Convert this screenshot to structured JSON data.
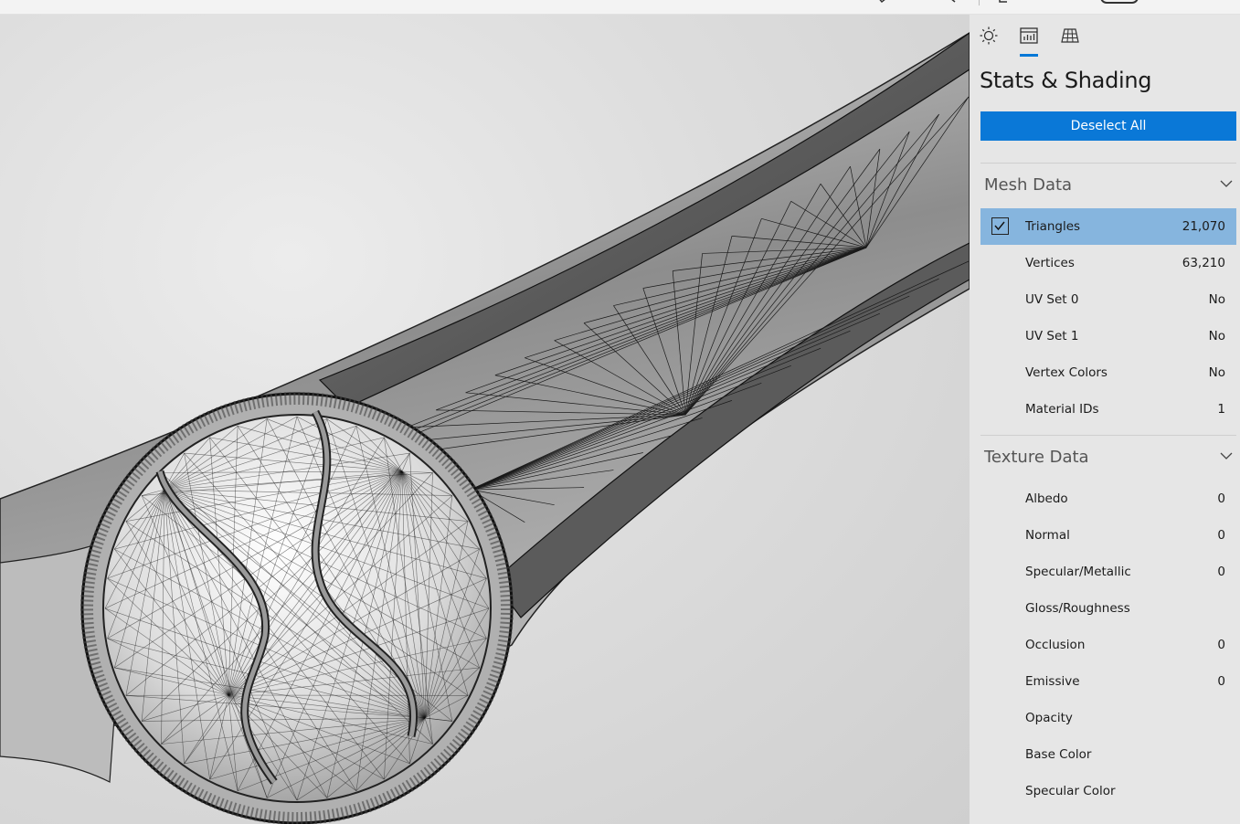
{
  "panel": {
    "title": "Stats & Shading",
    "tabs": [
      {
        "name": "lighting",
        "icon": "sun-icon"
      },
      {
        "name": "stats",
        "icon": "stats-icon",
        "active": true
      },
      {
        "name": "grid",
        "icon": "grid-icon"
      }
    ],
    "deselect_label": "Deselect All",
    "accent": "#0078d7",
    "selected_row_color": "#86b5de"
  },
  "mesh_data": {
    "header": "Mesh Data",
    "rows": [
      {
        "name": "Triangles",
        "value": "21,070",
        "selected": true
      },
      {
        "name": "Vertices",
        "value": "63,210"
      },
      {
        "name": "UV Set 0",
        "value": "No"
      },
      {
        "name": "UV Set 1",
        "value": "No"
      },
      {
        "name": "Vertex Colors",
        "value": "No"
      },
      {
        "name": "Material IDs",
        "value": "1"
      }
    ]
  },
  "texture_data": {
    "header": "Texture Data",
    "rows": [
      {
        "name": "Albedo",
        "value": "0"
      },
      {
        "name": "Normal",
        "value": "0"
      },
      {
        "name": "Specular/Metallic",
        "value": "0"
      },
      {
        "name": "Gloss/Roughness",
        "value": ""
      },
      {
        "name": "Occlusion",
        "value": "0"
      },
      {
        "name": "Emissive",
        "value": "0"
      },
      {
        "name": "Opacity",
        "value": ""
      },
      {
        "name": "Base Color",
        "value": ""
      },
      {
        "name": "Specular Color",
        "value": ""
      }
    ]
  }
}
